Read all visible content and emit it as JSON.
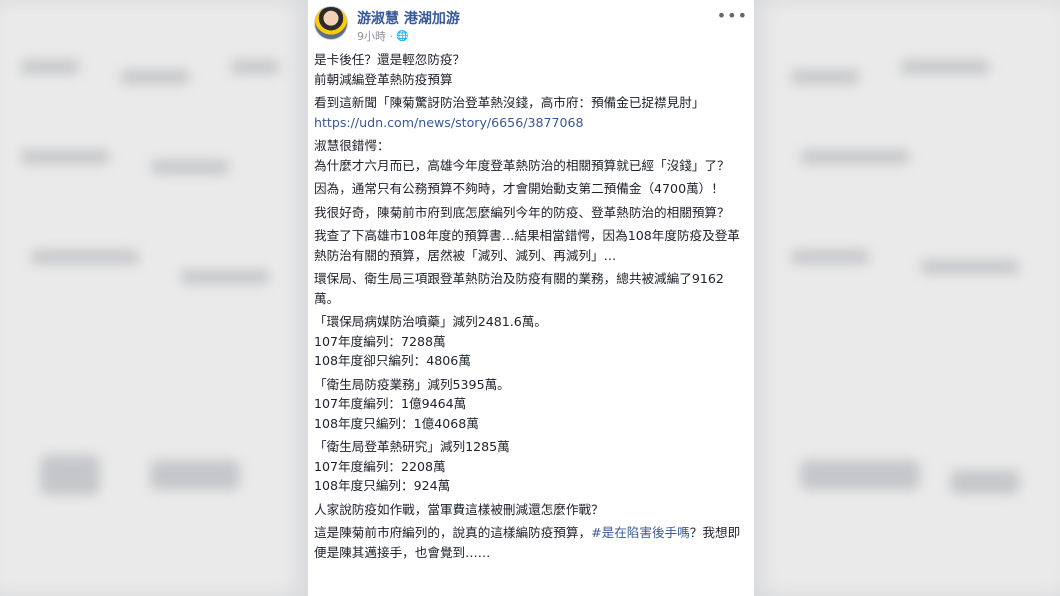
{
  "colors": {
    "link": "#385898",
    "text": "#1d2129",
    "meta": "#90949c",
    "background": "#d8d9dc"
  },
  "post": {
    "author": "游淑慧 港湖加游",
    "time": "9小時 · ",
    "privacy_icon": "globe-icon",
    "more_icon": "more-options-icon",
    "paragraphs": [
      "是卡後任？還是輕忽防疫？\n前朝減編登革熱防疫預算",
      "看到這新聞「陳菊驚訝防治登革熱沒錢，高市府：預備金已捉襟見肘」",
      "淑慧很錯愕：\n為什麼才六月而已，高雄今年度登革熱防治的相關預算就已經「沒錢」了？",
      "因為，通常只有公務預算不夠時，才會開始動支第二預備金（4700萬）！",
      "我很好奇，陳菊前市府到底怎麼編列今年的防疫、登革熱防治的相關預算？",
      "我查了下高雄市108年度的預算書…結果相當錯愕，因為108年度防疫及登革熱防治有關的預算，居然被「減列、減列、再減列」…",
      "環保局、衛生局三項跟登革熱防治及防疫有關的業務，總共被減編了9162萬。",
      "「環保局病媒防治噴藥」減列2481.6萬。\n107年度編列：7288萬\n108年度卻只編列：4806萬",
      "「衛生局防疫業務」減列5395萬。\n107年度編列：1億9464萬\n108年度只編列：1億4068萬",
      "「衛生局登革熱研究」減列1285萬\n107年度編列：2208萬\n108年度只編列：924萬",
      "人家說防疫如作戰，當軍費這樣被刪減還怎麼作戰？"
    ],
    "link": "https://udn.com/news/story/6656/3877068",
    "last_paragraph_start": "這是陳菊前市府編列的，說真的這樣編防疫預算，",
    "hashtag": "#是在陷害後手嗎",
    "last_paragraph_end": "？我想即便是陳其邁接手，也會覺到……"
  }
}
